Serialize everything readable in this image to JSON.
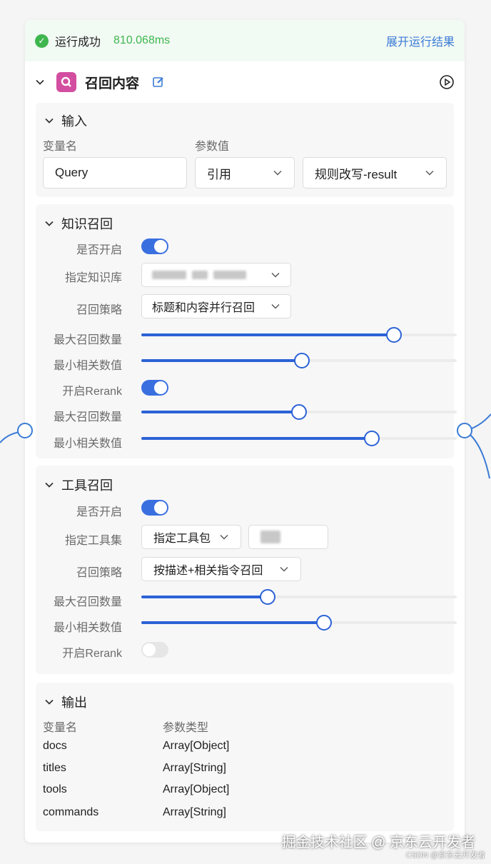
{
  "status": {
    "text": "运行成功",
    "time": "810.068ms",
    "expand_link": "展开运行结果"
  },
  "node": {
    "title": "召回内容",
    "icon": "search-icon"
  },
  "input": {
    "title": "输入",
    "col_var": "变量名",
    "col_val": "参数值",
    "var_value": "Query",
    "type_value": "引用",
    "ref_value": "规则改写-result"
  },
  "knowledge": {
    "title": "知识召回",
    "enable_label": "是否开启",
    "enabled": true,
    "kb_label": "指定知识库",
    "strategy_label": "召回策略",
    "strategy_value": "标题和内容并行召回",
    "max_label": "最大召回数量",
    "max_level": 0.8,
    "min_label": "最小相关数值",
    "min_level": 0.51,
    "rerank_label": "开启Rerank",
    "rerank_enabled": true,
    "rerank_max_label": "最大召回数量",
    "rerank_max_level": 0.5,
    "rerank_min_label": "最小相关数值",
    "rerank_min_level": 0.73
  },
  "tools": {
    "title": "工具召回",
    "enable_label": "是否开启",
    "enabled": true,
    "set_label": "指定工具集",
    "set_value": "指定工具包",
    "strategy_label": "召回策略",
    "strategy_value": "按描述+相关指令召回",
    "max_label": "最大召回数量",
    "max_level": 0.4,
    "min_label": "最小相关数值",
    "min_level": 0.58,
    "rerank_label": "开启Rerank",
    "rerank_enabled": false
  },
  "output": {
    "title": "输出",
    "col_var": "变量名",
    "col_type": "参数类型",
    "rows": [
      {
        "name": "docs",
        "type": "Array[Object]"
      },
      {
        "name": "titles",
        "type": "Array[String]"
      },
      {
        "name": "tools",
        "type": "Array[Object]"
      },
      {
        "name": "commands",
        "type": "Array[String]"
      }
    ]
  },
  "watermark": {
    "main": "掘金技术社区 @ 京东云开发者",
    "sub": "CSDN @京东云开发者"
  },
  "colors": {
    "accent": "#2c62d6",
    "success": "#3fb64d",
    "link": "#3a7bd5",
    "node_icon": "#d34ea0"
  }
}
